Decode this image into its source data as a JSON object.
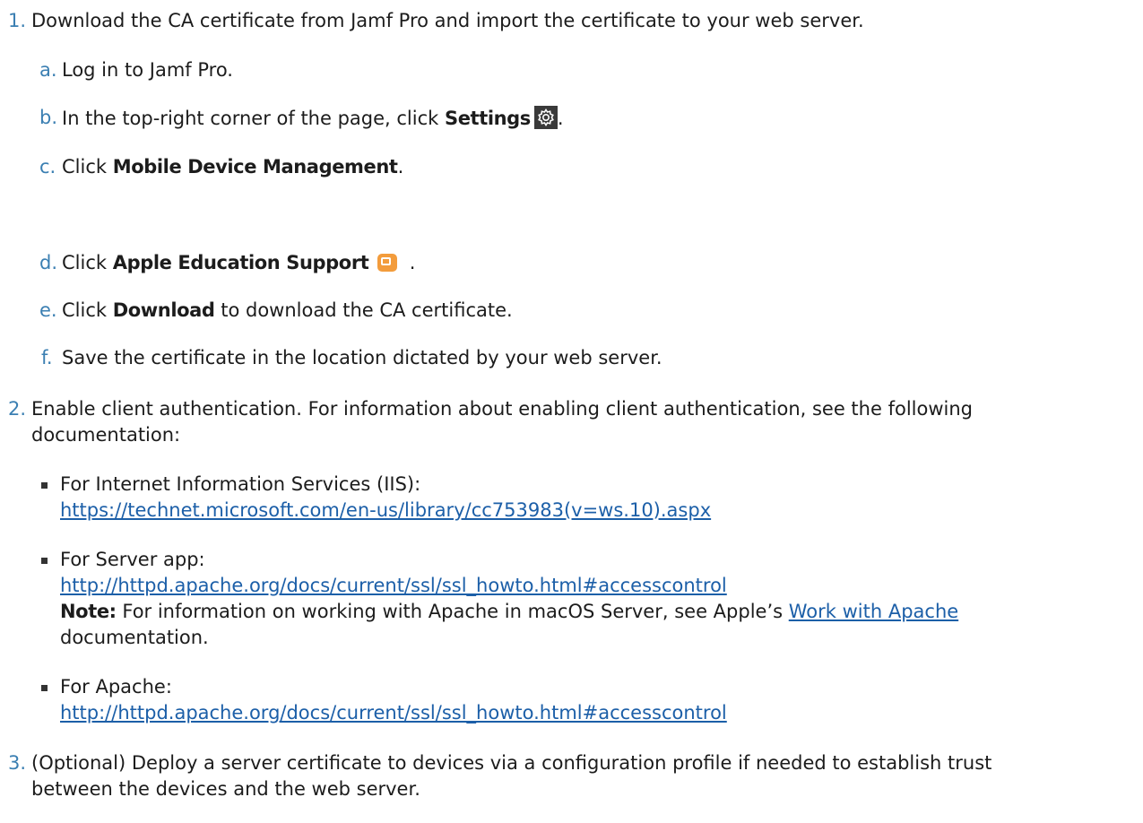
{
  "steps": [
    {
      "num": "1.",
      "text": "Download the CA certificate from Jamf Pro and import the certificate to your web server."
    },
    {
      "num": "2.",
      "line1": "Enable client authentication. For information about enabling client authentication, see the following",
      "line2": "documentation:"
    },
    {
      "num": "3.",
      "line1": "(Optional) Deploy a server certificate to devices via a configuration profile if needed to establish trust",
      "line2": "between the devices and the web server."
    }
  ],
  "substeps": {
    "a": {
      "letter": "a.",
      "text": "Log in to Jamf Pro."
    },
    "b": {
      "letter": "b.",
      "text": "In the top-right corner of the page, click ",
      "bold": "Settings",
      "after": ".",
      "icon": "gear-icon"
    },
    "c": {
      "letter": "c.",
      "text": "Click ",
      "bold": "Mobile Device Management",
      "after": "."
    },
    "d": {
      "letter": "d.",
      "text": "Click ",
      "bold": "Apple Education Support",
      "after": ".",
      "icon": "apple-education-support-icon"
    },
    "e": {
      "letter": "e.",
      "text": "Click ",
      "bold": "Download",
      "after": " to download the CA certificate."
    },
    "f": {
      "letter": "f.",
      "text": "Save the certificate in the location dictated by your web server."
    }
  },
  "bullets": [
    {
      "label": "For Internet Information Services (IIS):",
      "url": "https://technet.microsoft.com/en-us/library/cc753983(v=ws.10).aspx"
    },
    {
      "label": "For Server app:",
      "url": "http://httpd.apache.org/docs/current/ssl/ssl_howto.html#accesscontrol",
      "note_label": "Note:",
      "note_text": " For information on working with Apache in macOS Server, see Apple’s ",
      "note_link": "Work with Apache",
      "note_line2": "documentation."
    },
    {
      "label": "For Apache:",
      "url": "http://httpd.apache.org/docs/current/ssl/ssl_howto.html#accesscontrol"
    }
  ],
  "colors": {
    "numbering": "#3b7fb2",
    "link": "#1c5fa8",
    "icon_orange": "#f39c3c"
  }
}
